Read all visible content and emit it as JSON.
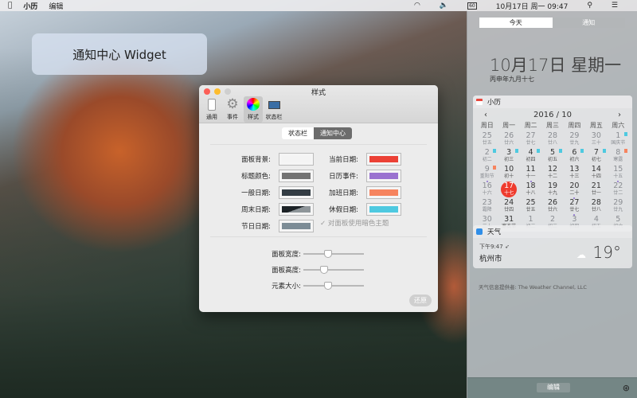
{
  "menubar": {
    "app": "小历",
    "menu": "编辑",
    "clock": "10月17日 周一 09:47"
  },
  "desktop_label": "通知中心 Widget",
  "window": {
    "title": "样式",
    "toolbar": [
      {
        "label": "通用",
        "icon": "phone-icon"
      },
      {
        "label": "事件",
        "icon": "gear-icon"
      },
      {
        "label": "样式",
        "icon": "color-wheel-icon",
        "selected": true
      },
      {
        "label": "状态栏",
        "icon": "laptop-icon"
      }
    ],
    "segments": [
      {
        "label": "状态栏",
        "selected": false
      },
      {
        "label": "通知中心",
        "selected": true
      }
    ],
    "colors_left": [
      {
        "label": "面板背景:",
        "color": "#f4f4f4"
      },
      {
        "label": "标题颜色:",
        "color": "#737373"
      },
      {
        "label": "一般日期:",
        "color": "#343d44"
      },
      {
        "label": "周末日期:",
        "color": "#1c2226",
        "color2": "#8e9599"
      },
      {
        "label": "节日日期:",
        "color": "#7c8c96"
      }
    ],
    "colors_right": [
      {
        "label": "当前日期:",
        "color": "#ec4136"
      },
      {
        "label": "日历事件:",
        "color": "#9a72d0"
      },
      {
        "label": "加班日期:",
        "color": "#f6845f"
      },
      {
        "label": "休假日期:",
        "color": "#4ec9e0"
      }
    ],
    "dark_theme_checkbox": {
      "label": "对面板使用暗色主题",
      "checked": true,
      "disabled": true
    },
    "sliders": [
      {
        "label": "面板宽度:",
        "value": 0.4
      },
      {
        "label": "面板高度:",
        "value": 0.32
      },
      {
        "label": "元素大小:",
        "value": 0.4
      }
    ],
    "restore_label": "还原"
  },
  "nc": {
    "tabs": [
      "今天",
      "通知"
    ],
    "date": "10月17日 星期一",
    "lunar": "丙申年九月十七",
    "calendar": {
      "title": "小历",
      "month": "2016 / 10",
      "prev": "‹",
      "next": "›",
      "weekdays": [
        "周日",
        "周一",
        "周二",
        "周三",
        "周四",
        "周五",
        "周六"
      ],
      "days": [
        {
          "d": "25",
          "l": "廿五",
          "dim": true
        },
        {
          "d": "26",
          "l": "廿六",
          "dim": true
        },
        {
          "d": "27",
          "l": "廿七",
          "dim": true
        },
        {
          "d": "28",
          "l": "廿八",
          "dim": true
        },
        {
          "d": "29",
          "l": "廿九",
          "dim": true
        },
        {
          "d": "30",
          "l": "三十",
          "dim": true
        },
        {
          "d": "1",
          "l": "国庆节",
          "mark": "#4ec9e0"
        },
        {
          "d": "2",
          "l": "初二",
          "mark": "#4ec9e0"
        },
        {
          "d": "3",
          "l": "初三",
          "mark": "#4ec9e0"
        },
        {
          "d": "4",
          "l": "初四",
          "mark": "#4ec9e0"
        },
        {
          "d": "5",
          "l": "初五",
          "mark": "#4ec9e0"
        },
        {
          "d": "6",
          "l": "初六",
          "mark": "#4ec9e0"
        },
        {
          "d": "7",
          "l": "初七",
          "mark": "#4ec9e0"
        },
        {
          "d": "8",
          "l": "寒露",
          "mark": "#f6845f"
        },
        {
          "d": "9",
          "l": "重阳节",
          "mark": "#f6845f",
          "dot": true
        },
        {
          "d": "10",
          "l": "初十"
        },
        {
          "d": "11",
          "l": "十一",
          "dot": true
        },
        {
          "d": "12",
          "l": "十二"
        },
        {
          "d": "13",
          "l": "十三"
        },
        {
          "d": "14",
          "l": "十四"
        },
        {
          "d": "15",
          "l": "十五",
          "dot": true
        },
        {
          "d": "16",
          "l": "十六"
        },
        {
          "d": "17",
          "l": "十七",
          "today": true
        },
        {
          "d": "18",
          "l": "十八"
        },
        {
          "d": "19",
          "l": "十九"
        },
        {
          "d": "20",
          "l": "二十",
          "dot": true
        },
        {
          "d": "21",
          "l": "廿一"
        },
        {
          "d": "22",
          "l": "廿二"
        },
        {
          "d": "23",
          "l": "霜降"
        },
        {
          "d": "24",
          "l": "廿四"
        },
        {
          "d": "25",
          "l": "廿五"
        },
        {
          "d": "26",
          "l": "廿六"
        },
        {
          "d": "27",
          "l": "廿七",
          "dot": true
        },
        {
          "d": "28",
          "l": "廿八"
        },
        {
          "d": "29",
          "l": "廿九"
        },
        {
          "d": "30",
          "l": "三十"
        },
        {
          "d": "31",
          "l": "寒衣节"
        },
        {
          "d": "1",
          "l": "初二",
          "dim": true
        },
        {
          "d": "2",
          "l": "初三",
          "dim": true
        },
        {
          "d": "3",
          "l": "初四",
          "dim": true
        },
        {
          "d": "4",
          "l": "初五",
          "dim": true
        },
        {
          "d": "5",
          "l": "初六",
          "dim": true
        }
      ]
    },
    "weather": {
      "title": "天气",
      "time": "下午9:47",
      "city": "杭州市",
      "temp": "19°",
      "icon": "partly-cloudy-icon"
    },
    "provider": "天气信息提供者: The Weather Channel, LLC",
    "edit_label": "编辑"
  }
}
